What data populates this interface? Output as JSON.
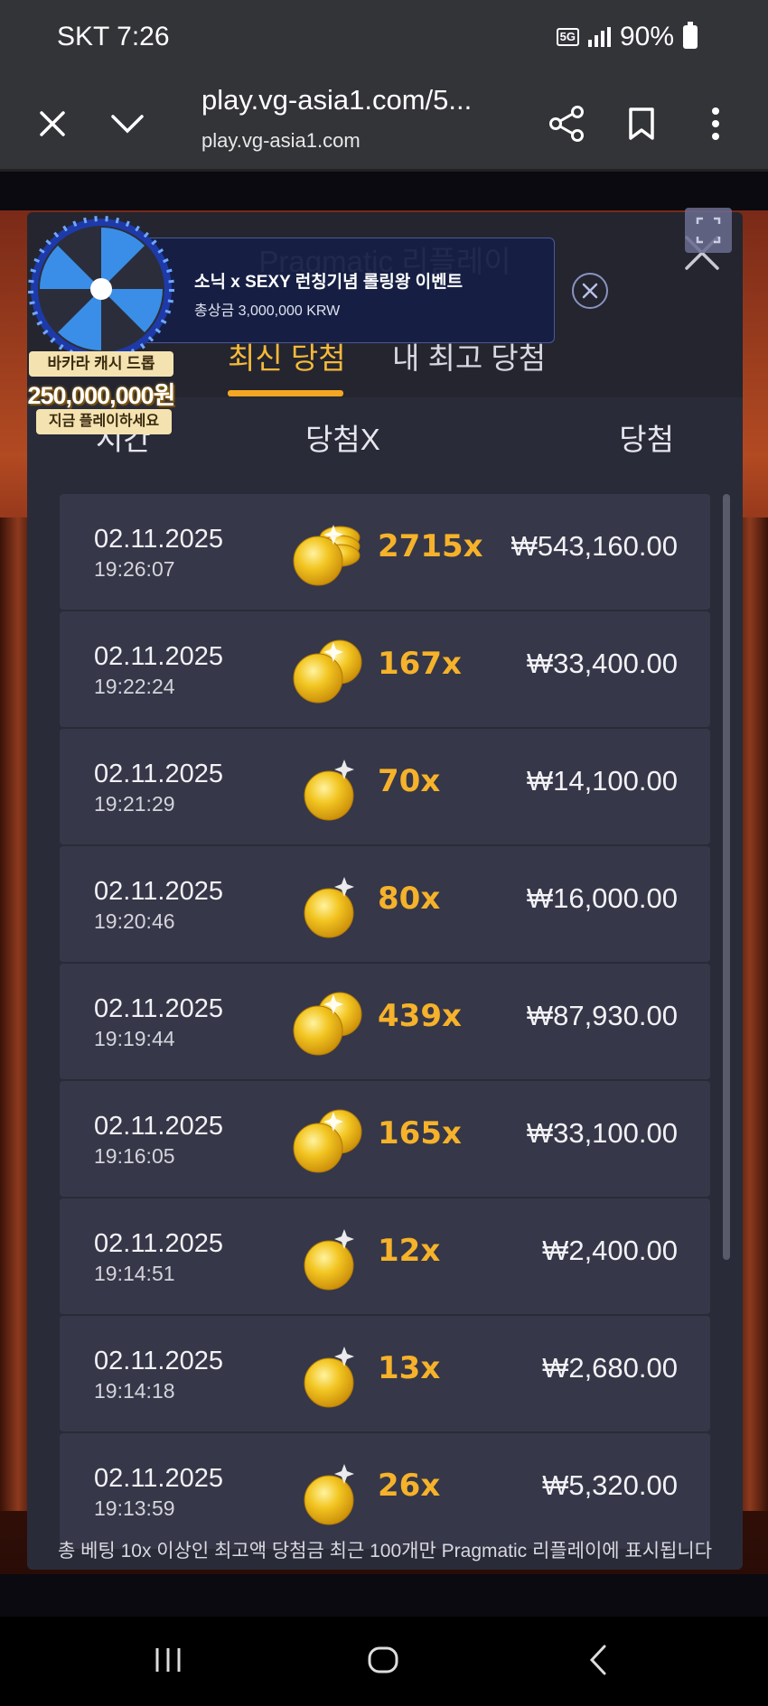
{
  "status_bar": {
    "carrier_time": "SKT 7:26",
    "network": "5G",
    "battery": "90%"
  },
  "browser": {
    "url": "play.vg-asia1.com/5...",
    "host": "play.vg-asia1.com"
  },
  "panel": {
    "title": "Pragmatic 리플레이",
    "tabs": [
      {
        "label": "최신 당첨",
        "active": true
      },
      {
        "label": "내 최고 당첨",
        "active": false
      }
    ],
    "columns": {
      "time": "시간",
      "multiplier": "당첨X",
      "win": "당첨"
    },
    "rows": [
      {
        "date": "02.11.2025",
        "time": "19:26:07",
        "multiplier": "2715x",
        "amount": "₩543,160.00",
        "coins": 3
      },
      {
        "date": "02.11.2025",
        "time": "19:22:24",
        "multiplier": "167x",
        "amount": "₩33,400.00",
        "coins": 2
      },
      {
        "date": "02.11.2025",
        "time": "19:21:29",
        "multiplier": "70x",
        "amount": "₩14,100.00",
        "coins": 1
      },
      {
        "date": "02.11.2025",
        "time": "19:20:46",
        "multiplier": "80x",
        "amount": "₩16,000.00",
        "coins": 1
      },
      {
        "date": "02.11.2025",
        "time": "19:19:44",
        "multiplier": "439x",
        "amount": "₩87,930.00",
        "coins": 2
      },
      {
        "date": "02.11.2025",
        "time": "19:16:05",
        "multiplier": "165x",
        "amount": "₩33,100.00",
        "coins": 2
      },
      {
        "date": "02.11.2025",
        "time": "19:14:51",
        "multiplier": "12x",
        "amount": "₩2,400.00",
        "coins": 1
      },
      {
        "date": "02.11.2025",
        "time": "19:14:18",
        "multiplier": "13x",
        "amount": "₩2,680.00",
        "coins": 1
      },
      {
        "date": "02.11.2025",
        "time": "19:13:59",
        "multiplier": "26x",
        "amount": "₩5,320.00",
        "coins": 1
      }
    ],
    "footer": "총 베팅 10x 이상인 최고액 당첨금 최근 100개만 Pragmatic 리플레이에 표시됩니다"
  },
  "promo": {
    "line1": "소닉 x SEXY 런칭기념 롤링왕 이벤트",
    "line2": "총상금 3,000,000 KRW"
  },
  "wheel_badge": {
    "top": "바카라 캐시 드롭",
    "amount": "250,000,000원",
    "cta": "지금 플레이하세요"
  },
  "colors": {
    "accent": "#f5a623",
    "panel": "#2a2b38",
    "row": "#363748",
    "coin": "#f2c521"
  }
}
